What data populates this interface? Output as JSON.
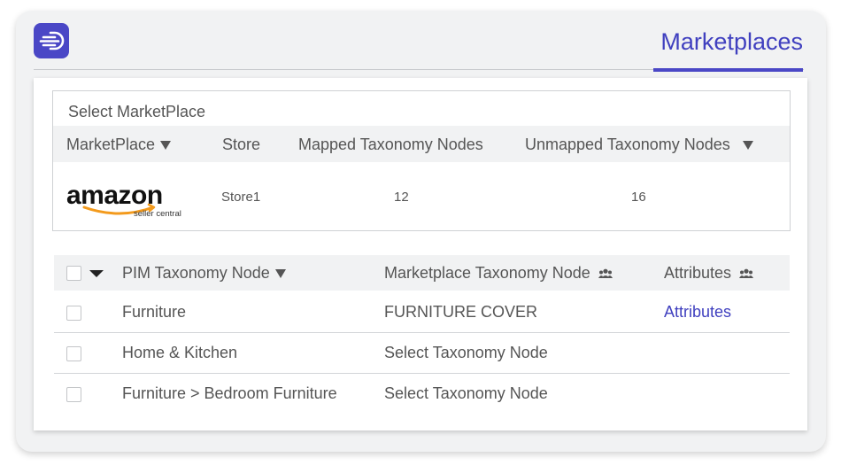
{
  "header": {
    "active_tab": "Marketplaces",
    "logo_icon": "menu-arrow-logo-icon",
    "accent_color": "#4a47c6"
  },
  "marketplace_section": {
    "title": "Select MarketPlace",
    "columns": [
      "MarketPlace",
      "Store",
      "Mapped Taxonomy Nodes",
      "Unmapped Taxonomy Nodes"
    ],
    "rows": [
      {
        "marketplace_logo": "amazon",
        "logo_sub": "seller central",
        "store": "Store1",
        "mapped": "12",
        "unmapped": "16"
      }
    ]
  },
  "taxonomy_table": {
    "columns": [
      "PIM Taxonomy Node",
      "Marketplace Taxonomy Node",
      "Attributes"
    ],
    "rows": [
      {
        "pim": "Furniture",
        "marketplace": "FURNITURE COVER",
        "attributes": "Attributes"
      },
      {
        "pim": "Home & Kitchen",
        "marketplace": "Select Taxonomy Node",
        "attributes": ""
      },
      {
        "pim": "Furniture > Bedroom Furniture",
        "marketplace": "Select Taxonomy Node",
        "attributes": ""
      }
    ]
  }
}
